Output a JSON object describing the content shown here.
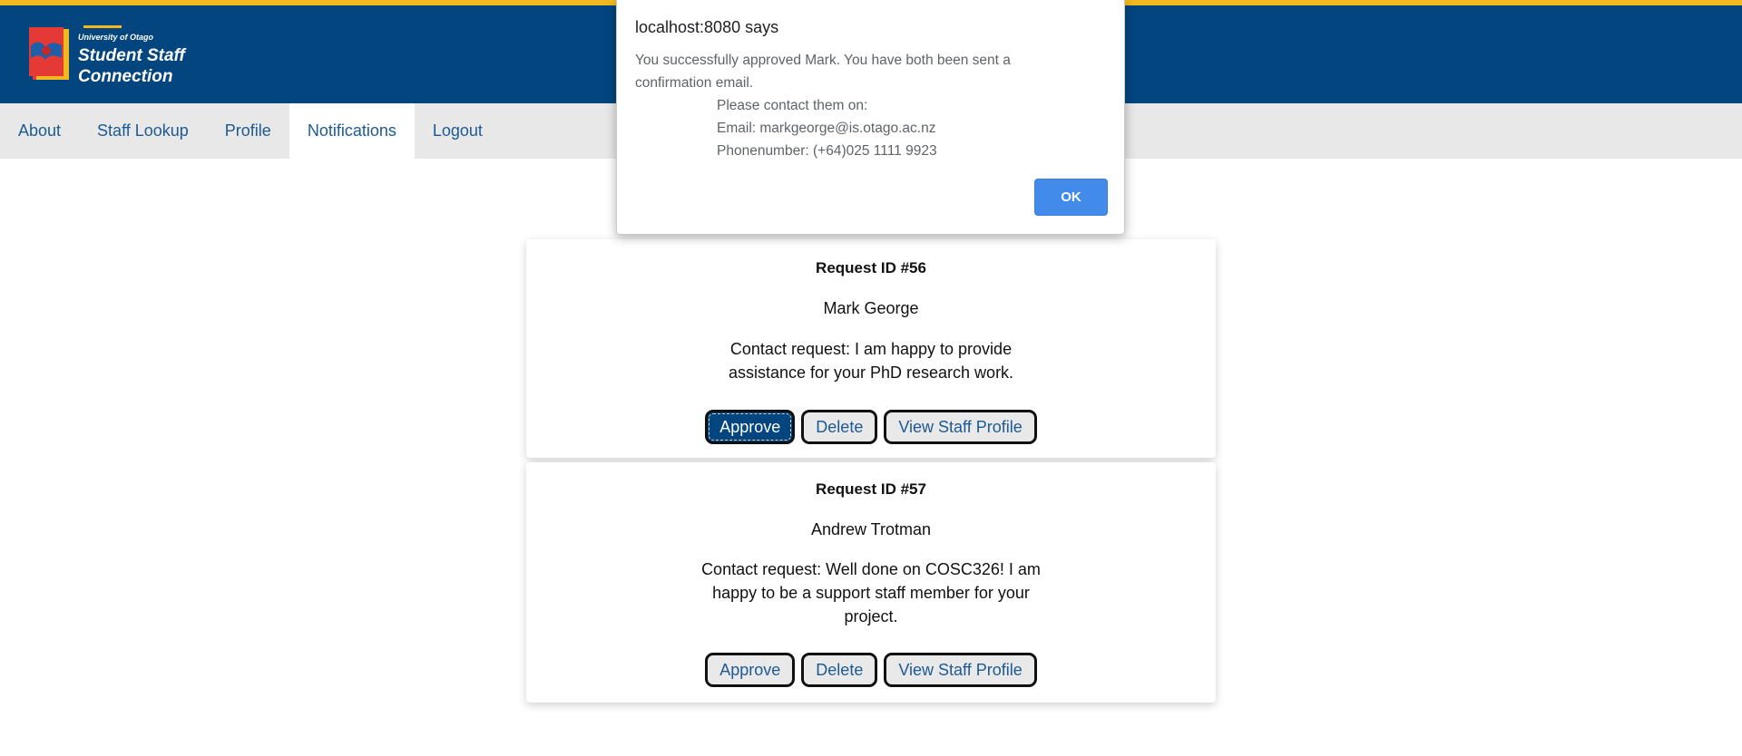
{
  "brand": {
    "university": "University of Otago",
    "title_line1": "Student Staff",
    "title_line2": "Connection"
  },
  "nav": {
    "items": [
      {
        "label": "About"
      },
      {
        "label": "Staff Lookup"
      },
      {
        "label": "Profile"
      },
      {
        "label": "Notifications"
      },
      {
        "label": "Logout"
      }
    ],
    "active": "Notifications"
  },
  "requests": [
    {
      "id_label": "Request ID #56",
      "name": "Mark George",
      "message": "Contact request: I am happy to provide assistance for your PhD research work.",
      "buttons": {
        "approve": "Approve",
        "delete": "Delete",
        "view": "View Staff Profile"
      }
    },
    {
      "id_label": "Request ID #57",
      "name": "Andrew Trotman",
      "message": "Contact request: Well done on COSC326! I am happy to be a support staff member for your project.",
      "buttons": {
        "approve": "Approve",
        "delete": "Delete",
        "view": "View Staff Profile"
      }
    }
  ],
  "dialog": {
    "title": "localhost:8080 says",
    "line1": "You successfully approved Mark. You have both been sent a",
    "line2": "confirmation email.",
    "line3": "Please contact them on:",
    "line4": "Email: markgeorge@is.otago.ac.nz",
    "line5": "Phonenumber: (+64)025 1111 9923",
    "ok_label": "OK"
  },
  "colors": {
    "header_blue": "#02457f",
    "accent_gold": "#f2b81f",
    "nav_link": "#1d5a93",
    "dialog_button": "#428bea"
  }
}
